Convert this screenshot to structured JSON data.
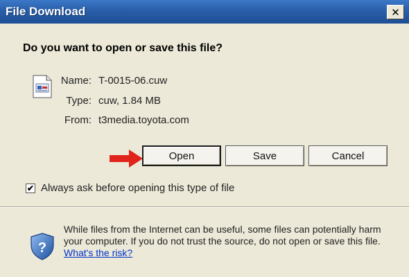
{
  "window": {
    "title": "File Download",
    "close_glyph": "✕"
  },
  "dialog": {
    "heading": "Do you want to open or save this file?",
    "file_icon": "document-icon",
    "file": {
      "name_label": "Name:",
      "name_value": "T-0015-06.cuw",
      "type_label": "Type:",
      "type_value": "cuw, 1.84 MB",
      "from_label": "From:",
      "from_value": "t3media.toyota.com"
    },
    "buttons": {
      "open": "Open",
      "save": "Save",
      "cancel": "Cancel"
    },
    "arrow_color": "#e0231b",
    "checkbox": {
      "checked": true,
      "label": "Always ask before opening this type of file"
    },
    "warning": {
      "icon": "shield-question-icon",
      "text": "While files from the Internet can be useful, some files can potentially harm your computer. If you do not trust the source, do not open or save this file.",
      "link": "What's the risk?"
    }
  },
  "colors": {
    "titlebar": "#2a5ea8",
    "dialog_bg": "#ece9d8",
    "link": "#0033cc"
  }
}
